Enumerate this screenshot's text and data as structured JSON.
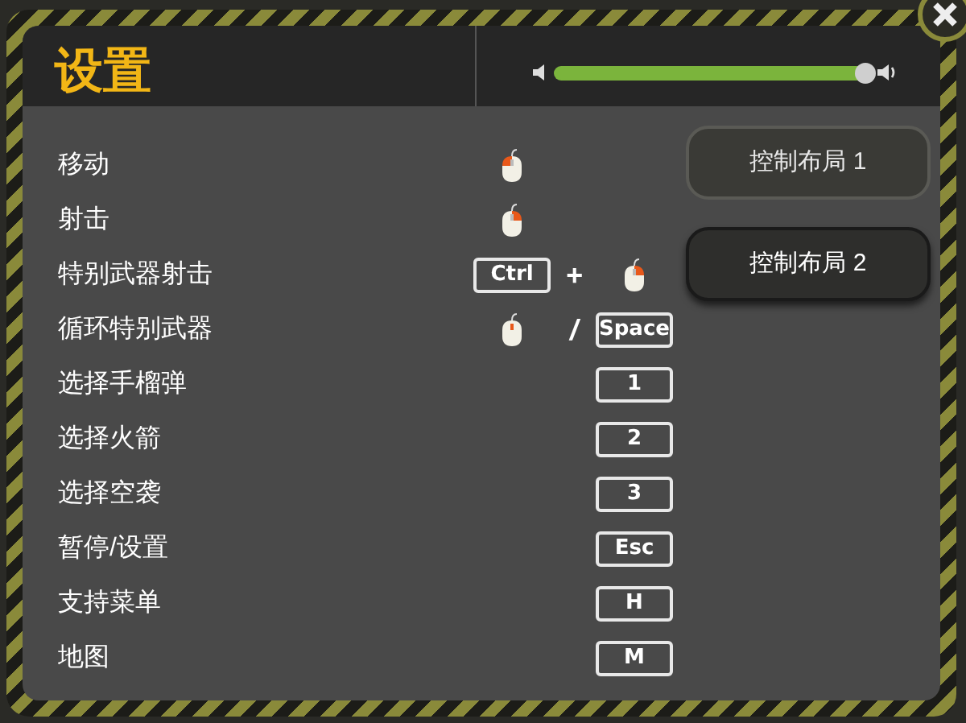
{
  "window": {
    "title": "设置"
  },
  "volume": {
    "level": 0.97
  },
  "layout_buttons": [
    {
      "label": "控制布局 1",
      "selected": true
    },
    {
      "label": "控制布局 2",
      "selected": false
    }
  ],
  "bindings": [
    {
      "action": "移动",
      "inputs": [
        {
          "kind": "leftclick"
        }
      ]
    },
    {
      "action": "射击",
      "inputs": [
        {
          "kind": "rightclick"
        }
      ]
    },
    {
      "action": "特别武器射击",
      "inputs": [
        {
          "kind": "key",
          "text": "Ctrl"
        },
        {
          "kind": "sep",
          "text": "+"
        },
        {
          "kind": "rightclick"
        }
      ]
    },
    {
      "action": "循环特别武器",
      "inputs": [
        {
          "kind": "middleclick"
        },
        {
          "kind": "sep",
          "text": "/"
        },
        {
          "kind": "key",
          "text": "Space"
        }
      ]
    },
    {
      "action": "选择手榴弹",
      "inputs": [
        {
          "kind": "key",
          "text": "1"
        }
      ]
    },
    {
      "action": "选择火箭",
      "inputs": [
        {
          "kind": "key",
          "text": "2"
        }
      ]
    },
    {
      "action": "选择空袭",
      "inputs": [
        {
          "kind": "key",
          "text": "3"
        }
      ]
    },
    {
      "action": "暂停/设置",
      "inputs": [
        {
          "kind": "key",
          "text": "Esc"
        }
      ]
    },
    {
      "action": "支持菜单",
      "inputs": [
        {
          "kind": "key",
          "text": "H"
        }
      ]
    },
    {
      "action": "地图",
      "inputs": [
        {
          "kind": "key",
          "text": "M"
        }
      ]
    }
  ]
}
